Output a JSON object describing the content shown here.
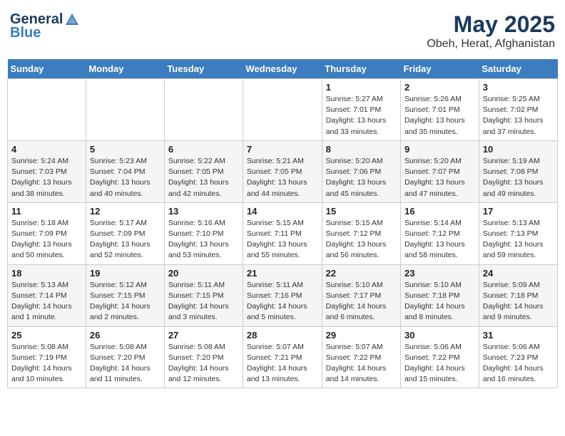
{
  "logo": {
    "line1": "General",
    "line2": "Blue"
  },
  "title": "May 2025",
  "subtitle": "Obeh, Herat, Afghanistan",
  "days_of_week": [
    "Sunday",
    "Monday",
    "Tuesday",
    "Wednesday",
    "Thursday",
    "Friday",
    "Saturday"
  ],
  "weeks": [
    [
      {
        "num": "",
        "info": ""
      },
      {
        "num": "",
        "info": ""
      },
      {
        "num": "",
        "info": ""
      },
      {
        "num": "",
        "info": ""
      },
      {
        "num": "1",
        "info": "Sunrise: 5:27 AM\nSunset: 7:01 PM\nDaylight: 13 hours\nand 33 minutes."
      },
      {
        "num": "2",
        "info": "Sunrise: 5:26 AM\nSunset: 7:01 PM\nDaylight: 13 hours\nand 35 minutes."
      },
      {
        "num": "3",
        "info": "Sunrise: 5:25 AM\nSunset: 7:02 PM\nDaylight: 13 hours\nand 37 minutes."
      }
    ],
    [
      {
        "num": "4",
        "info": "Sunrise: 5:24 AM\nSunset: 7:03 PM\nDaylight: 13 hours\nand 38 minutes."
      },
      {
        "num": "5",
        "info": "Sunrise: 5:23 AM\nSunset: 7:04 PM\nDaylight: 13 hours\nand 40 minutes."
      },
      {
        "num": "6",
        "info": "Sunrise: 5:22 AM\nSunset: 7:05 PM\nDaylight: 13 hours\nand 42 minutes."
      },
      {
        "num": "7",
        "info": "Sunrise: 5:21 AM\nSunset: 7:05 PM\nDaylight: 13 hours\nand 44 minutes."
      },
      {
        "num": "8",
        "info": "Sunrise: 5:20 AM\nSunset: 7:06 PM\nDaylight: 13 hours\nand 45 minutes."
      },
      {
        "num": "9",
        "info": "Sunrise: 5:20 AM\nSunset: 7:07 PM\nDaylight: 13 hours\nand 47 minutes."
      },
      {
        "num": "10",
        "info": "Sunrise: 5:19 AM\nSunset: 7:08 PM\nDaylight: 13 hours\nand 49 minutes."
      }
    ],
    [
      {
        "num": "11",
        "info": "Sunrise: 5:18 AM\nSunset: 7:09 PM\nDaylight: 13 hours\nand 50 minutes."
      },
      {
        "num": "12",
        "info": "Sunrise: 5:17 AM\nSunset: 7:09 PM\nDaylight: 13 hours\nand 52 minutes."
      },
      {
        "num": "13",
        "info": "Sunrise: 5:16 AM\nSunset: 7:10 PM\nDaylight: 13 hours\nand 53 minutes."
      },
      {
        "num": "14",
        "info": "Sunrise: 5:15 AM\nSunset: 7:11 PM\nDaylight: 13 hours\nand 55 minutes."
      },
      {
        "num": "15",
        "info": "Sunrise: 5:15 AM\nSunset: 7:12 PM\nDaylight: 13 hours\nand 56 minutes."
      },
      {
        "num": "16",
        "info": "Sunrise: 5:14 AM\nSunset: 7:12 PM\nDaylight: 13 hours\nand 58 minutes."
      },
      {
        "num": "17",
        "info": "Sunrise: 5:13 AM\nSunset: 7:13 PM\nDaylight: 13 hours\nand 59 minutes."
      }
    ],
    [
      {
        "num": "18",
        "info": "Sunrise: 5:13 AM\nSunset: 7:14 PM\nDaylight: 14 hours\nand 1 minute."
      },
      {
        "num": "19",
        "info": "Sunrise: 5:12 AM\nSunset: 7:15 PM\nDaylight: 14 hours\nand 2 minutes."
      },
      {
        "num": "20",
        "info": "Sunrise: 5:11 AM\nSunset: 7:15 PM\nDaylight: 14 hours\nand 3 minutes."
      },
      {
        "num": "21",
        "info": "Sunrise: 5:11 AM\nSunset: 7:16 PM\nDaylight: 14 hours\nand 5 minutes."
      },
      {
        "num": "22",
        "info": "Sunrise: 5:10 AM\nSunset: 7:17 PM\nDaylight: 14 hours\nand 6 minutes."
      },
      {
        "num": "23",
        "info": "Sunrise: 5:10 AM\nSunset: 7:18 PM\nDaylight: 14 hours\nand 8 minutes."
      },
      {
        "num": "24",
        "info": "Sunrise: 5:09 AM\nSunset: 7:18 PM\nDaylight: 14 hours\nand 9 minutes."
      }
    ],
    [
      {
        "num": "25",
        "info": "Sunrise: 5:08 AM\nSunset: 7:19 PM\nDaylight: 14 hours\nand 10 minutes."
      },
      {
        "num": "26",
        "info": "Sunrise: 5:08 AM\nSunset: 7:20 PM\nDaylight: 14 hours\nand 11 minutes."
      },
      {
        "num": "27",
        "info": "Sunrise: 5:08 AM\nSunset: 7:20 PM\nDaylight: 14 hours\nand 12 minutes."
      },
      {
        "num": "28",
        "info": "Sunrise: 5:07 AM\nSunset: 7:21 PM\nDaylight: 14 hours\nand 13 minutes."
      },
      {
        "num": "29",
        "info": "Sunrise: 5:07 AM\nSunset: 7:22 PM\nDaylight: 14 hours\nand 14 minutes."
      },
      {
        "num": "30",
        "info": "Sunrise: 5:06 AM\nSunset: 7:22 PM\nDaylight: 14 hours\nand 15 minutes."
      },
      {
        "num": "31",
        "info": "Sunrise: 5:06 AM\nSunset: 7:23 PM\nDaylight: 14 hours\nand 16 minutes."
      }
    ]
  ]
}
